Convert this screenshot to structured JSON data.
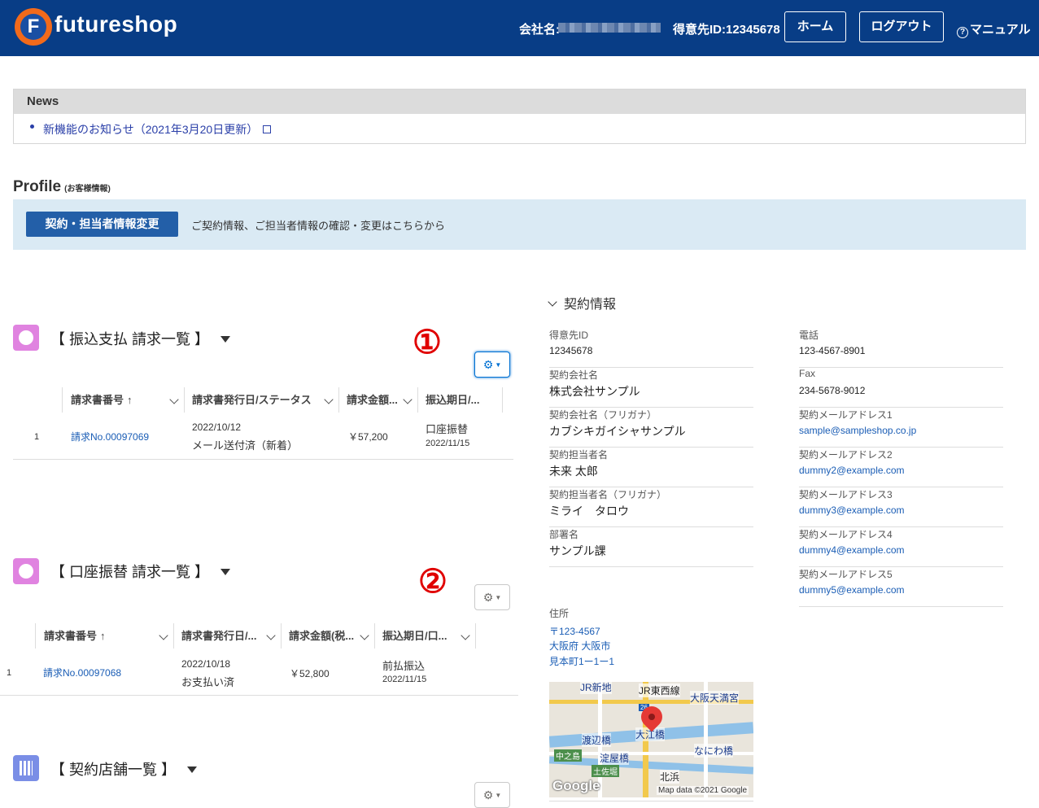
{
  "header": {
    "logo_text": "futureshop",
    "logo_letter": "F",
    "company_label": "会社名:",
    "customer_id": "得意先ID:12345678",
    "home_button": "ホーム",
    "logout_button": "ログアウト",
    "manual_link": "マニュアル",
    "manual_icon": "?"
  },
  "news": {
    "heading": "News",
    "items": [
      {
        "label": "新機能のお知らせ（2021年3月20日更新）"
      }
    ]
  },
  "profile": {
    "title": "Profile",
    "subtitle": "(お客様情報)",
    "change_button": "契約・担当者情報変更",
    "description": "ご契約情報、ご担当者情報の確認・変更はこちらから"
  },
  "annotations": {
    "one": "①",
    "two": "②"
  },
  "transfer_invoices": {
    "title": "【 振込支払 請求一覧 】",
    "columns": [
      "請求書番号",
      "請求書発行日/ステータス",
      "請求金額...",
      "振込期日/..."
    ],
    "sort_indicator": "↑",
    "rows": [
      {
        "index": "1",
        "invoice_no": "請求No.00097069",
        "issue_date": "2022/10/12",
        "status": "メール送付済（新着）",
        "amount": "￥57,200",
        "method": "口座振替",
        "due_date": "2022/11/15"
      }
    ]
  },
  "debit_invoices": {
    "title": "【 口座振替 請求一覧 】",
    "columns": [
      "請求書番号",
      "請求書発行日/...",
      "請求金額(税...",
      "振込期日/口..."
    ],
    "sort_indicator": "↑",
    "rows": [
      {
        "index": "1",
        "invoice_no": "請求No.00097068",
        "issue_date": "2022/10/18",
        "status": "お支払い済",
        "amount": "￥52,800",
        "method": "前払振込",
        "due_date": "2022/11/15"
      }
    ]
  },
  "stores": {
    "title": "【 契約店舗一覧 】"
  },
  "contract_info": {
    "heading": "契約情報",
    "left_fields": [
      {
        "label": "得意先ID",
        "value": "12345678"
      },
      {
        "label": "契約会社名",
        "value": "株式会社サンプル"
      },
      {
        "label": "契約会社名（フリガナ）",
        "value": "カブシキガイシャサンプル"
      },
      {
        "label": "契約担当者名",
        "value": "未来 太郎"
      },
      {
        "label": "契約担当者名（フリガナ）",
        "value": "ミライ　タロウ"
      },
      {
        "label": "部署名",
        "value": "サンプル課"
      }
    ],
    "right_fields": [
      {
        "label": "電話",
        "value": "123-4567-8901"
      },
      {
        "label": "Fax",
        "value": "234-5678-9012"
      },
      {
        "label": "契約メールアドレス1",
        "value": "sample@sampleshop.co.jp"
      },
      {
        "label": "契約メールアドレス2",
        "value": "dummy2@example.com"
      },
      {
        "label": "契約メールアドレス3",
        "value": "dummy3@example.com"
      },
      {
        "label": "契約メールアドレス4",
        "value": "dummy4@example.com"
      },
      {
        "label": "契約メールアドレス5",
        "value": "dummy5@example.com"
      }
    ],
    "address_label": "住所",
    "address_lines": [
      "〒123-4567",
      "大阪府 大阪市",
      "見本町1ー1ー1"
    ],
    "map": {
      "labels": [
        "JR新地",
        "JR東西線",
        "大阪天満宮",
        "渡辺橋",
        "大江橋",
        "なにわ橋",
        "中之島",
        "淀屋橋",
        "土佐堀",
        "北浜"
      ],
      "route_number": "26",
      "google": "Google",
      "attribution": "Map data ©2021 Google"
    }
  },
  "colors": {
    "header_bg": "#083d86",
    "accent": "#235fa8",
    "link": "#1a5db5",
    "annotation": "#e00000"
  }
}
